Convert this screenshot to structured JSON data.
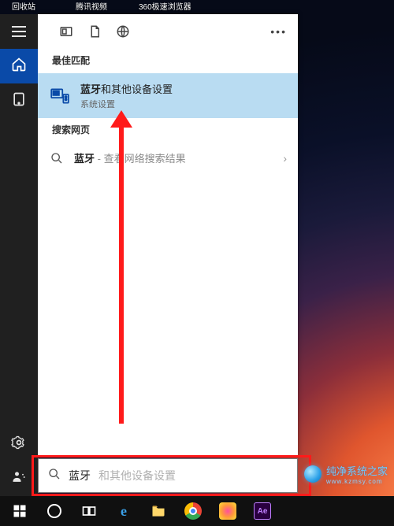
{
  "desktop_icons": [
    "回收站",
    "腾讯视频",
    "360极速浏览器"
  ],
  "panel": {
    "best_header": "最佳匹配",
    "best_result": {
      "keyword": "蓝牙",
      "rest": "和其他设备设置",
      "subtitle": "系统设置"
    },
    "web_header": "搜索网页",
    "web_result": {
      "keyword": "蓝牙",
      "suffix": " - 查看网络搜索结果"
    }
  },
  "search": {
    "typed": "蓝牙",
    "ghost": "和其他设备设置"
  },
  "watermark": {
    "title": "纯净系统之家",
    "sub": "www.kzmsy.com"
  },
  "taskbar": {
    "ae_label": "Ae"
  }
}
